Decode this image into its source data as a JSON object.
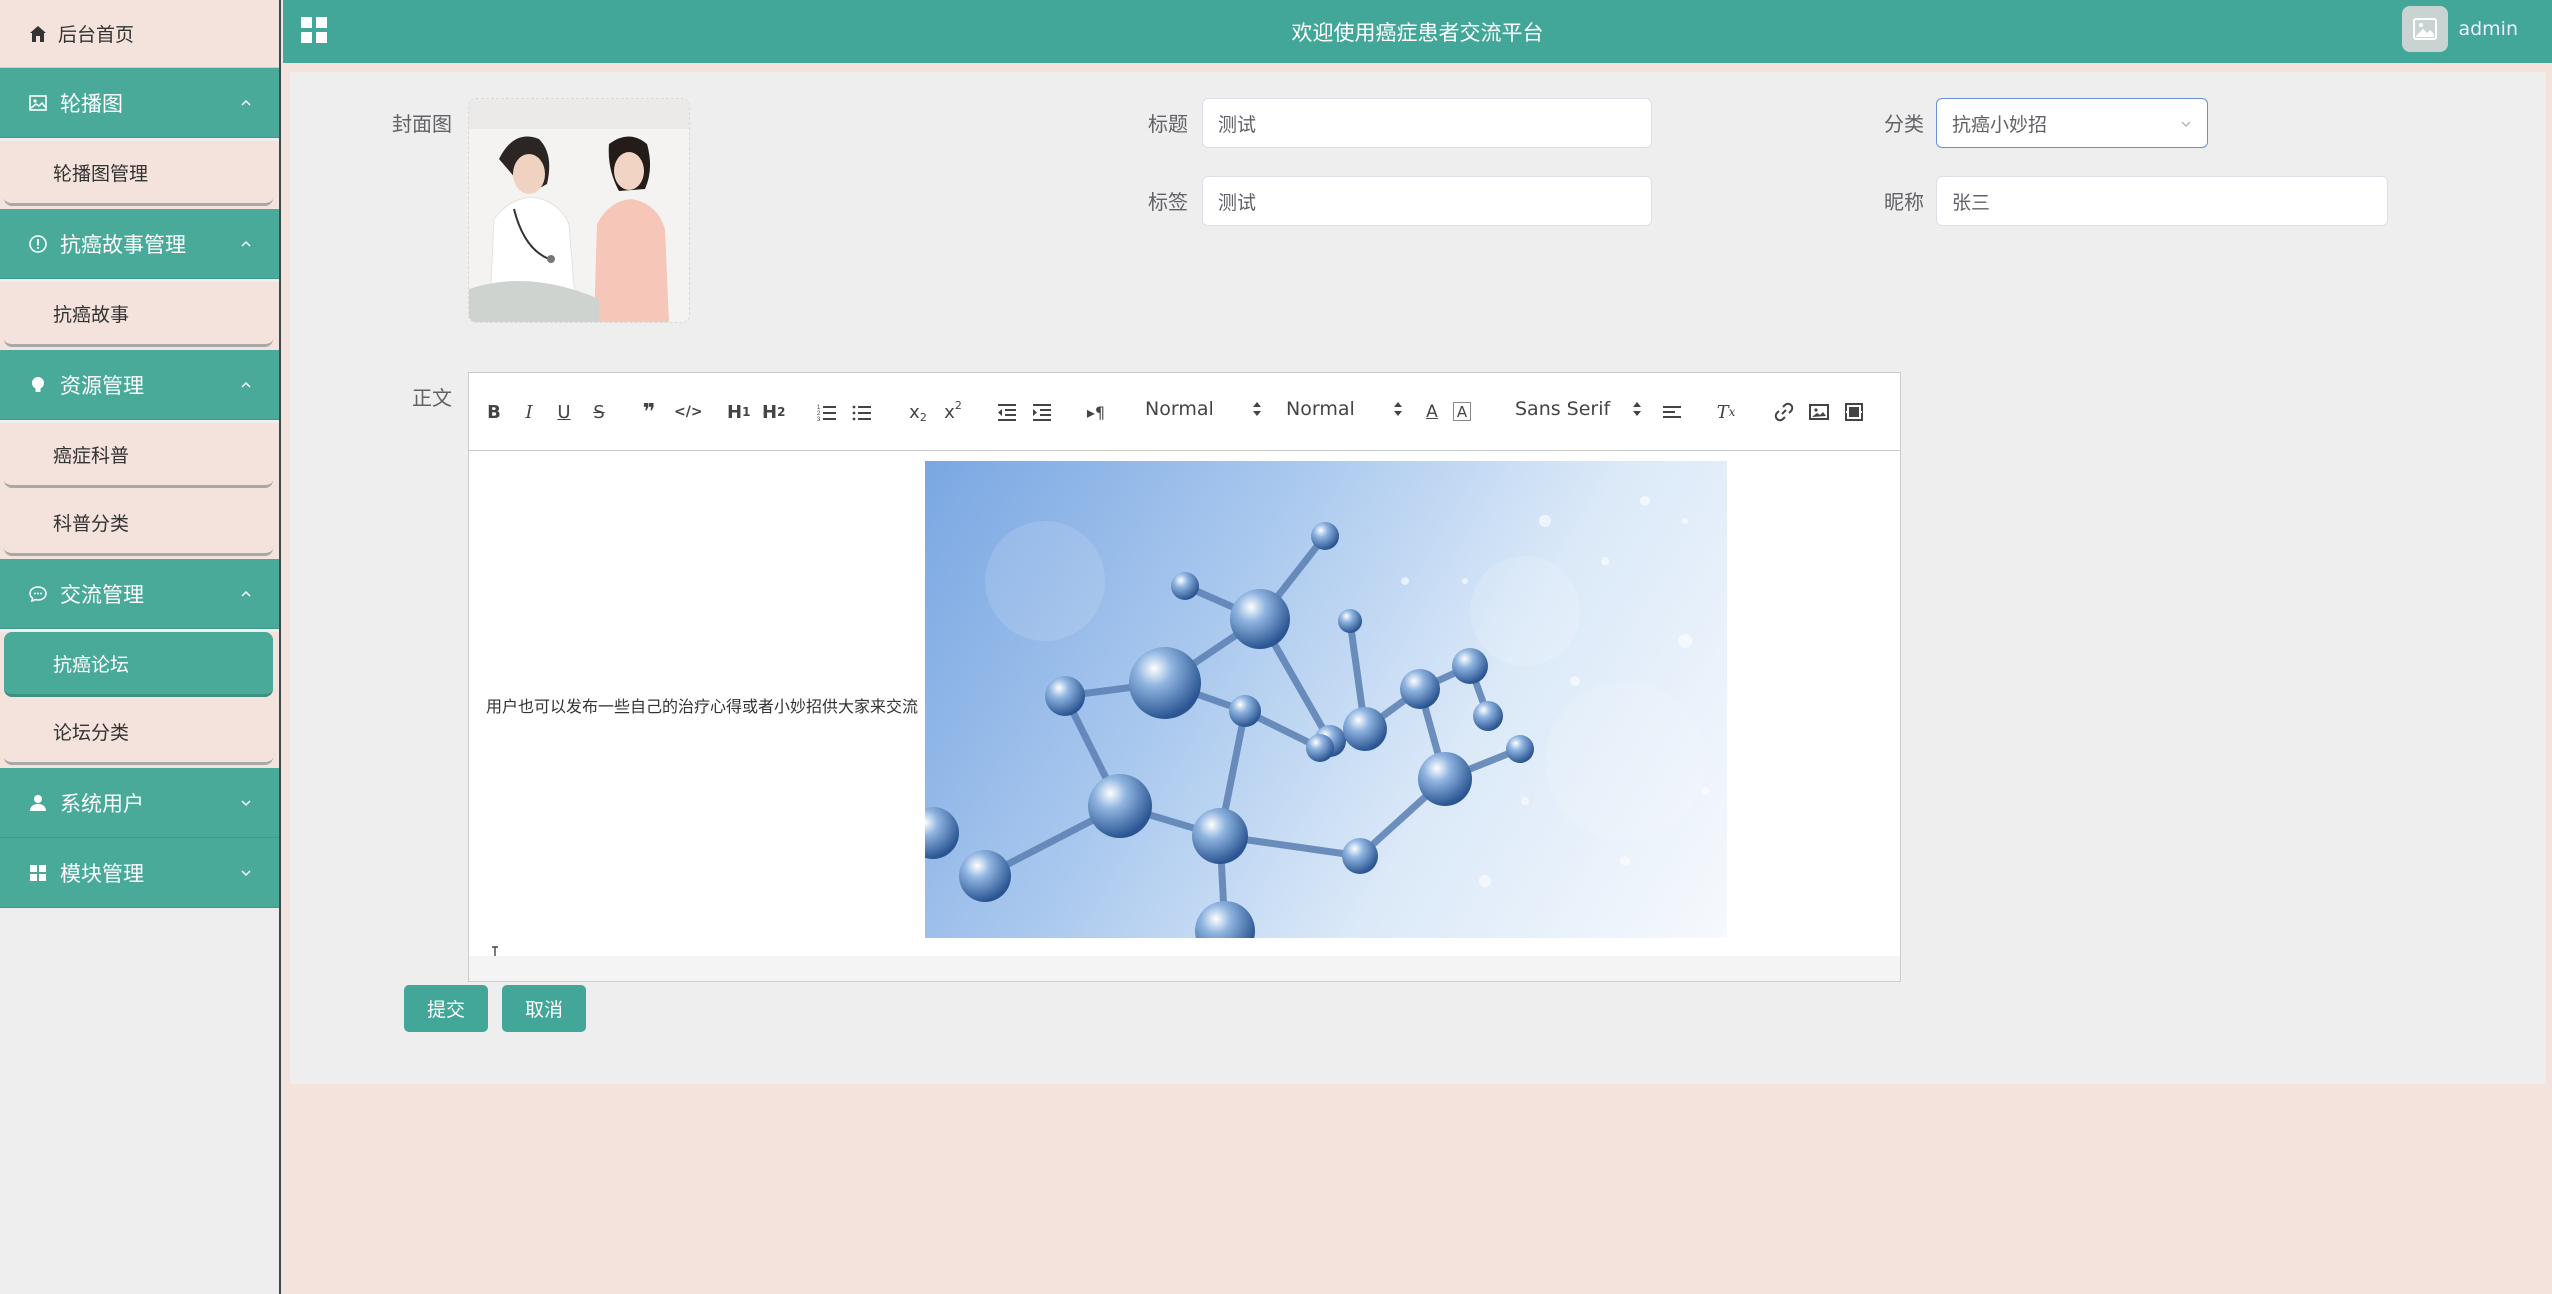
{
  "header": {
    "title": "欢迎使用癌症患者交流平台",
    "username": "admin"
  },
  "sidebar": {
    "home": "后台首页",
    "groups": [
      {
        "label": "轮播图",
        "items": [
          "轮播图管理"
        ],
        "expanded": true
      },
      {
        "label": "抗癌故事管理",
        "items": [
          "抗癌故事"
        ],
        "expanded": true
      },
      {
        "label": "资源管理",
        "items": [
          "癌症科普",
          "科普分类"
        ],
        "expanded": true
      },
      {
        "label": "交流管理",
        "items": [
          "抗癌论坛",
          "论坛分类"
        ],
        "expanded": true,
        "active_item": "抗癌论坛"
      },
      {
        "label": "系统用户",
        "items": [],
        "expanded": false
      },
      {
        "label": "模块管理",
        "items": [],
        "expanded": false
      }
    ]
  },
  "form": {
    "cover_label": "封面图",
    "title_label": "标题",
    "title_value": "测试",
    "category_label": "分类",
    "category_value": "抗癌小妙招",
    "tag_label": "标签",
    "tag_value": "测试",
    "nickname_label": "昵称",
    "nickname_value": "张三",
    "body_label": "正文"
  },
  "editor": {
    "header_select": "Normal",
    "size_select": "Normal",
    "font_select": "Sans Serif",
    "content_text": "用户也可以发布一些自己的治疗心得或者小妙招供大家来交流"
  },
  "buttons": {
    "submit": "提交",
    "cancel": "取消"
  },
  "colors": {
    "accent": "#42a698",
    "sidebar_sub_bg": "#f4e2dc",
    "panel_bg": "#eeeeee"
  }
}
